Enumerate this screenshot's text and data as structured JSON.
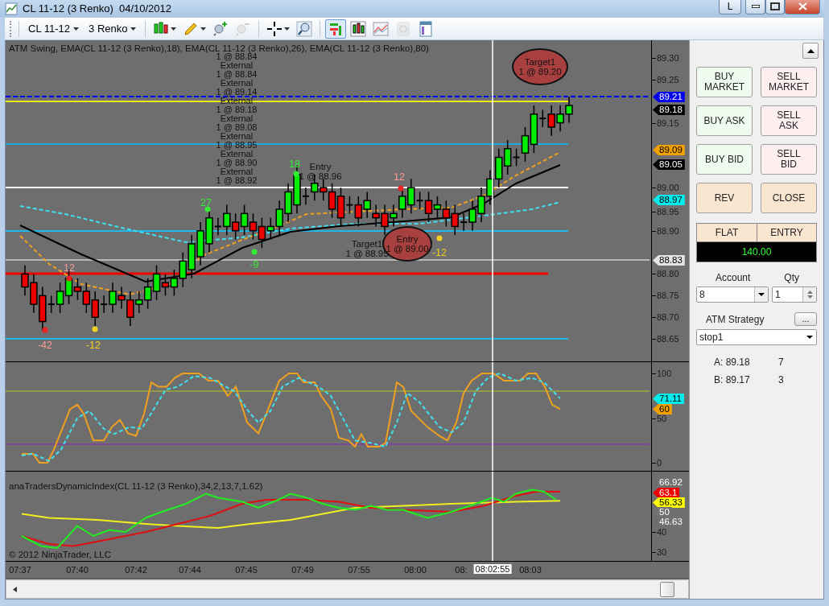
{
  "window": {
    "title": "CL 11-12 (3 Renko)  04/10/2012",
    "layout_button": "L"
  },
  "toolbar": {
    "instrument": "CL 11-12",
    "bar_type": "3 Renko",
    "tools": [
      {
        "kind": "candles",
        "selected": false,
        "disabled": false
      },
      {
        "kind": "pencil",
        "selected": false,
        "disabled": false
      },
      {
        "kind": "add_indicator",
        "selected": false,
        "disabled": false
      },
      {
        "kind": "remove_indicator",
        "selected": false,
        "disabled": true
      },
      {
        "kind": "crosshair",
        "selected": false,
        "disabled": false
      },
      {
        "kind": "zoom",
        "selected": false,
        "disabled": false
      },
      {
        "kind": "chart_trader",
        "selected": true,
        "disabled": false
      },
      {
        "kind": "bars",
        "selected": false,
        "disabled": false
      },
      {
        "kind": "line",
        "selected": false,
        "disabled": false
      },
      {
        "kind": "dollar",
        "selected": false,
        "disabled": true
      },
      {
        "kind": "properties",
        "selected": false,
        "disabled": false
      }
    ]
  },
  "price_panel": {
    "title": "ATM Swing, EMA(CL 11-12 (3 Renko),18), EMA(CL 11-12 (3 Renko),26), EMA(CL 11-12 (3 Renko),80)",
    "execution_stack": [
      "1 @ 88.84",
      "External",
      "1 @ 88.84",
      "External",
      "1 @ 89.14",
      "External",
      "1 @ 89.18",
      "External",
      "1 @ 89.08",
      "External",
      "1 @ 88.95",
      "External",
      "1 @ 88.90",
      "External",
      "1 @ 88.92"
    ],
    "trade_labels": [
      {
        "kind": "plain",
        "title": "Entry",
        "detail": "1 @ 88.96"
      },
      {
        "kind": "plain",
        "title": "Target1",
        "detail": "1 @ 88.95"
      },
      {
        "kind": "bubble",
        "title": "Entry",
        "detail": "1 @ 89.00"
      },
      {
        "kind": "bubble",
        "title": "Target1",
        "detail": "1 @ 89.20"
      }
    ],
    "swing_labels": [
      {
        "text": "27",
        "color": "#33ee33"
      },
      {
        "text": "18",
        "color": "#33ee33"
      },
      {
        "text": "12",
        "color": "#ee2222"
      },
      {
        "text": "-9",
        "color": "#33ee33"
      },
      {
        "text": "-12",
        "color": "#f0d020"
      },
      {
        "text": "-42",
        "color": "#ee2222"
      },
      {
        "text": "-12",
        "color": "#f0d020"
      },
      {
        "text": "12",
        "color": "#ee2222"
      }
    ],
    "axis_labels": [
      "89.30",
      "89.25",
      "89.15",
      "89.00",
      "88.95",
      "88.90",
      "88.80",
      "88.75",
      "88.70",
      "88.65"
    ],
    "price_tags": [
      {
        "text": "89.21",
        "color": "#0000ee"
      },
      {
        "text": "89.18",
        "color": "#000000"
      },
      {
        "text": "89.09",
        "color": "#f0a000"
      },
      {
        "text": "89.05",
        "color": "#000000"
      },
      {
        "text": "88.97",
        "color": "#00eeee"
      },
      {
        "text": "88.83",
        "color": "#e4e4e4"
      }
    ]
  },
  "oscillator_panel": {
    "axis_labels": [
      "100",
      "50",
      "0"
    ],
    "value_tags": [
      {
        "text": "71.11",
        "color": "#00eeee"
      },
      {
        "text": "60",
        "color": "#f0a000"
      }
    ]
  },
  "dynamic_index_panel": {
    "title": "anaTradersDynamicIndex(CL 11-12 (3 Renko),34,2,13,7,1.62)",
    "axis_labels": [
      "40",
      "30"
    ],
    "value_tags": [
      {
        "text": "66.92",
        "color": "#707070"
      },
      {
        "text": "63.1",
        "color": "#ee0000"
      },
      {
        "text": "56.33",
        "color": "#ffff00"
      },
      {
        "text": "50",
        "color": "#707070"
      },
      {
        "text": "46.63",
        "color": "#707070"
      }
    ],
    "copyright": "© 2012 NinjaTrader, LLC"
  },
  "time_axis": {
    "labels": [
      "07:37",
      "07:40",
      "07:42",
      "07:44",
      "07:45",
      "07:49",
      "07:55",
      "08:00",
      "08:",
      "08:03"
    ],
    "crosshair_time": "08:02:55"
  },
  "order_panel": {
    "buttons": [
      {
        "label": "BUY MARKET",
        "kind": "buy"
      },
      {
        "label": "SELL MARKET",
        "kind": "sell"
      },
      {
        "label": "BUY ASK",
        "kind": "buy"
      },
      {
        "label": "SELL ASK",
        "kind": "sell"
      },
      {
        "label": "BUY BID",
        "kind": "buy"
      },
      {
        "label": "SELL BID",
        "kind": "sell"
      },
      {
        "label": "REV",
        "kind": "neutral"
      },
      {
        "label": "CLOSE",
        "kind": "neutral"
      }
    ],
    "position": {
      "status": "FLAT",
      "mode": "ENTRY",
      "pnl": "140.00"
    },
    "account": {
      "label": "Account",
      "value": "8"
    },
    "quantity": {
      "label": "Qty",
      "value": "1"
    },
    "atm_strategy": {
      "label": "ATM Strategy",
      "button": "...",
      "value": "stop1"
    },
    "quotes": [
      {
        "price": "A: 89.18",
        "size": "7"
      },
      {
        "price": "B: 89.17",
        "size": "3"
      }
    ]
  }
}
